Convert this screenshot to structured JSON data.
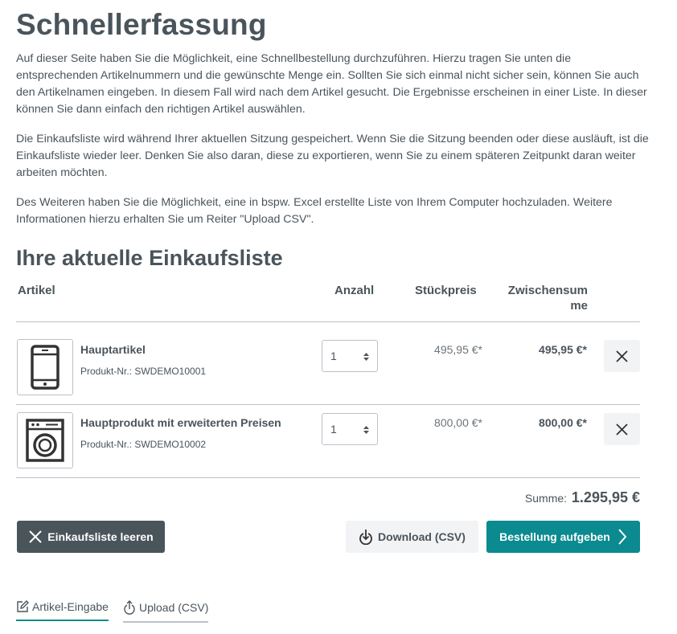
{
  "page": {
    "title": "Schnellerfassung",
    "intro": [
      "Auf dieser Seite haben Sie die Möglichkeit, eine Schnellbestellung durchzuführen. Hierzu tragen Sie unten die entsprechenden Artikelnummern und die gewünschte Menge ein. Sollten Sie sich einmal nicht sicher sein, können Sie auch den Artikelnamen eingeben. In diesem Fall wird nach dem Artikel gesucht. Die Ergebnisse erscheinen in einer Liste. In dieser können Sie dann einfach den richtigen Artikel auswählen.",
      "Die Einkaufsliste wird während Ihrer aktuellen Sitzung gespeichert. Wenn Sie die Sitzung beenden oder diese ausläuft, ist die Einkaufsliste wieder leer. Denken Sie also daran, diese zu exportieren, wenn Sie zu einem späteren Zeitpunkt daran weiter arbeiten möchten.",
      "Des Weiteren haben Sie die Möglichkeit, eine in bspw. Excel erstellte Liste von Ihrem Computer hochzuladen. Weitere Informationen hierzu erhalten Sie um Reiter \"Upload CSV\"."
    ]
  },
  "cart": {
    "title": "Ihre aktuelle Einkaufsliste",
    "columns": {
      "article": "Artikel",
      "quantity": "Anzahl",
      "unit_price": "Stückpreis",
      "subtotal_line1": "Zwischensum",
      "subtotal_line2": "me"
    },
    "items": [
      {
        "name": "Hauptartikel",
        "number": "Produkt-Nr.: SWDEMO10001",
        "quantity": "1",
        "unit_price": "495,95 €*",
        "subtotal": "495,95 €*",
        "image_icon": "smartphone-icon"
      },
      {
        "name": "Hauptprodukt mit erweiterten Preisen",
        "number": "Produkt-Nr.: SWDEMO10002",
        "quantity": "1",
        "unit_price": "800,00 €*",
        "subtotal": "800,00 €*",
        "image_icon": "washing-machine-icon"
      }
    ],
    "sum_label": "Summe:",
    "sum_value": "1.295,95 €"
  },
  "actions": {
    "clear": "Einkaufsliste leeren",
    "download": "Download (CSV)",
    "order": "Bestellung aufgeben"
  },
  "tabs": [
    {
      "label": "Artikel-Eingabe",
      "icon": "edit-icon",
      "active": true
    },
    {
      "label": "Upload (CSV)",
      "icon": "upload-icon",
      "active": false
    }
  ],
  "colors": {
    "text": "#4a545b",
    "primary": "#0b8a8f",
    "dark_button": "#4a545b",
    "light_button": "#f2f3f5",
    "border": "#bcc1c7"
  }
}
